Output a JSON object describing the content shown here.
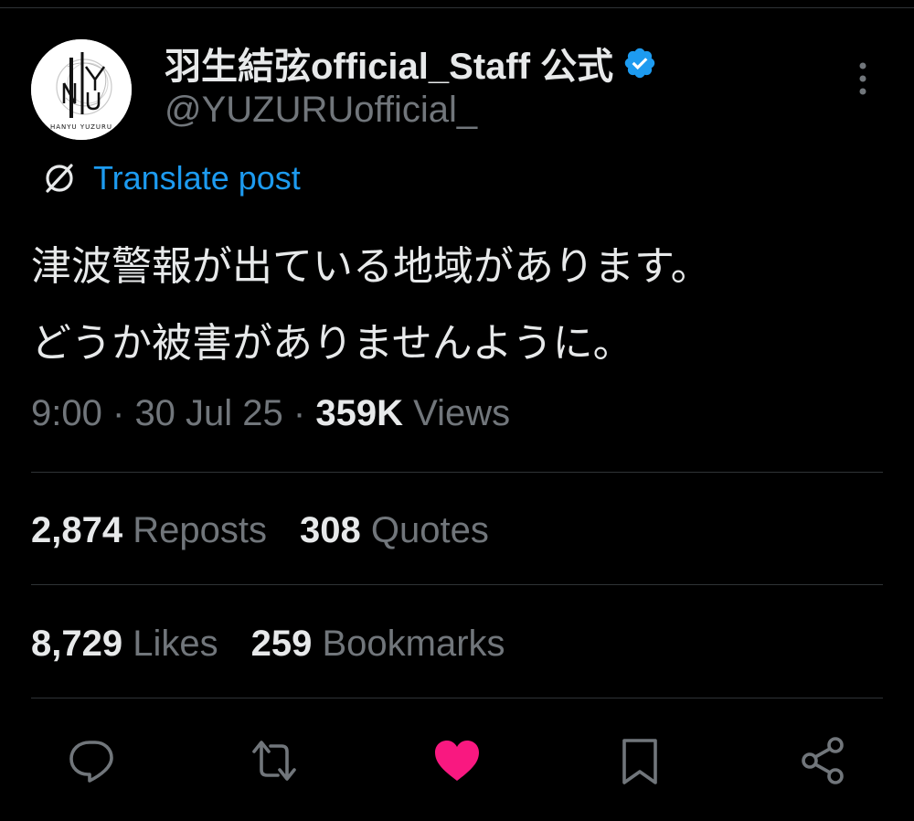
{
  "author": {
    "display_name": "羽生結弦official_Staff 公式",
    "handle": "@YUZURUofficial_",
    "verified": true,
    "avatar_text": "HANYU YUZURU",
    "avatar_monogram": "HANYU"
  },
  "translate": {
    "label": "Translate post",
    "icon": "translate-icon"
  },
  "post": {
    "lines": [
      "津波警報が出ている地域があります。",
      "どうか被害がありませんように。"
    ]
  },
  "meta": {
    "time": "9:00",
    "separator": "·",
    "date": "30 Jul 25",
    "views_count": "359K",
    "views_label": "Views"
  },
  "stats": {
    "reposts_count": "2,874",
    "reposts_label": "Reposts",
    "quotes_count": "308",
    "quotes_label": "Quotes",
    "likes_count": "8,729",
    "likes_label": "Likes",
    "bookmarks_count": "259",
    "bookmarks_label": "Bookmarks"
  },
  "actions": [
    {
      "name": "reply",
      "icon": "reply-icon"
    },
    {
      "name": "repost",
      "icon": "repost-icon"
    },
    {
      "name": "like",
      "icon": "heart-icon",
      "active": true
    },
    {
      "name": "bookmark",
      "icon": "bookmark-icon"
    },
    {
      "name": "share",
      "icon": "share-icon"
    }
  ],
  "colors": {
    "background": "#000000",
    "text_primary": "#e7e9ea",
    "text_secondary": "#71767b",
    "link": "#1d9bf0",
    "verified": "#1d9bf0",
    "like_active": "#f91880",
    "divider": "#2f3336"
  }
}
